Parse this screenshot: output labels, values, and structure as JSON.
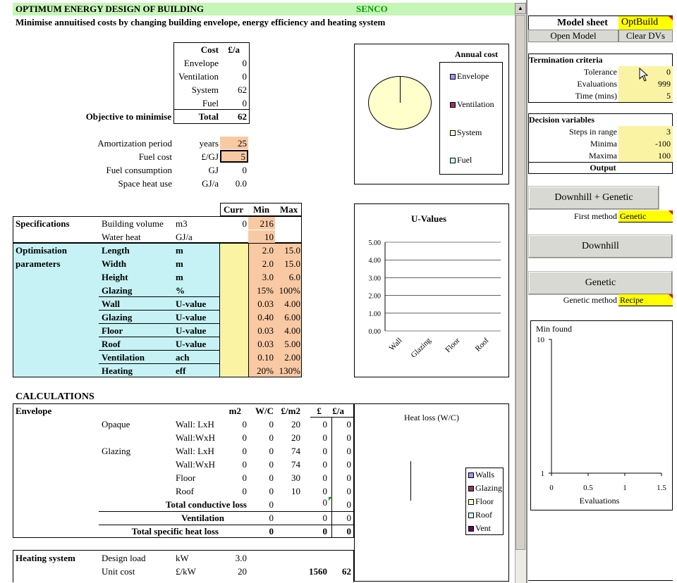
{
  "header": {
    "title": "OPTIMUM ENERGY DESIGN OF BUILDING",
    "brand": "SENCO",
    "subtitle": "Minimise annuitised costs by changing building envelope, energy efficiency and heating system"
  },
  "cost_table": {
    "col1": "Cost",
    "col2": "£/a",
    "rows": [
      {
        "label": "Envelope",
        "value": "0"
      },
      {
        "label": "Ventilation",
        "value": "0"
      },
      {
        "label": "System",
        "value": "62"
      },
      {
        "label": "Fuel",
        "value": "0"
      }
    ],
    "objective_label": "Objective to minimise",
    "total_label": "Total",
    "total_value": "62"
  },
  "params": [
    {
      "label": "Amortization period",
      "unit": "years",
      "value": "25"
    },
    {
      "label": "Fuel cost",
      "unit": "£/GJ",
      "value": "5"
    },
    {
      "label": "Fuel consumption",
      "unit": "GJ",
      "value": "0"
    },
    {
      "label": "Space heat use",
      "unit": "GJ/a",
      "value": "0.0"
    }
  ],
  "annual_chart": {
    "title": "Annual cost",
    "legend": [
      "Envelope",
      "Ventilation",
      "System",
      "Fuel"
    ],
    "colors": [
      "#9999ff",
      "#993366",
      "#ffffcc",
      "#ccffff"
    ]
  },
  "spec": {
    "h_curr": "Curr",
    "h_min": "Min",
    "h_max": "Max",
    "specifications": "Specifications",
    "building_volume": "Building volume",
    "bv_unit": "m3",
    "bv_curr": "0",
    "bv_min": "216",
    "water_heat": "Water heat",
    "wh_unit": "GJ/a",
    "wh_min": "10",
    "opt_label1": "Optimisation",
    "opt_label2": "parameters",
    "rows": [
      {
        "name": "Length",
        "unit": "m",
        "min": "2.0",
        "max": "15.0"
      },
      {
        "name": "Width",
        "unit": "m",
        "min": "2.0",
        "max": "15.0"
      },
      {
        "name": "Height",
        "unit": "m",
        "min": "3.0",
        "max": "6.0"
      },
      {
        "name": "Glazing",
        "unit": "%",
        "min": "15%",
        "max": "100%"
      },
      {
        "name": "Wall",
        "unit": "U-value",
        "min": "0.03",
        "max": "4.00"
      },
      {
        "name": "Glazing",
        "unit": "U-value",
        "min": "0.40",
        "max": "6.00"
      },
      {
        "name": "Floor",
        "unit": "U-value",
        "min": "0.03",
        "max": "4.00"
      },
      {
        "name": "Roof",
        "unit": "U-value",
        "min": "0.03",
        "max": "5.00"
      },
      {
        "name": "Ventilation",
        "unit": "ach",
        "min": "0.10",
        "max": "2.00"
      },
      {
        "name": "Heating",
        "unit": "eff",
        "min": "20%",
        "max": "130%"
      }
    ]
  },
  "chart_data": [
    {
      "type": "pie",
      "title": "Annual cost",
      "categories": [
        "Envelope",
        "Ventilation",
        "System",
        "Fuel"
      ],
      "values": [
        0,
        0,
        62,
        0
      ]
    },
    {
      "type": "bar",
      "title": "U-Values",
      "categories": [
        "Wall",
        "Glazing",
        "Floor",
        "Roof"
      ],
      "values": [
        0,
        0,
        0,
        0
      ],
      "ylim": [
        0,
        5
      ],
      "yticks": [
        "5.00",
        "4.00",
        "3.00",
        "2.00",
        "1.00",
        "0.00"
      ]
    },
    {
      "type": "scatter",
      "title": "Min found",
      "xlabel": "Evaluations",
      "xlim": [
        0,
        1.5
      ],
      "ylim": [
        1,
        10
      ],
      "xticks": [
        "0",
        "0.5",
        "1",
        "1.5"
      ],
      "yticks": [
        "10",
        "1"
      ]
    },
    {
      "type": "bar",
      "title": "Heat loss (W/C)",
      "categories": [
        "Walls",
        "Glazing",
        "Floor",
        "Roof",
        "Vent"
      ],
      "values": [
        0,
        0,
        0,
        0,
        0
      ]
    }
  ],
  "calc": {
    "title": "CALCULATIONS",
    "envelope": "Envelope",
    "headers": [
      "m2",
      "W/C",
      "£/m2",
      "£",
      "£/a"
    ],
    "rows": [
      {
        "group": "Opaque",
        "item": "Wall: LxH",
        "m2": "0",
        "wc": "0",
        "pm2": "20",
        "p": "0",
        "pa": "0"
      },
      {
        "group": "",
        "item": "Wall:WxH",
        "m2": "0",
        "wc": "0",
        "pm2": "20",
        "p": "0",
        "pa": "0"
      },
      {
        "group": "Glazing",
        "item": "Wall: LxH",
        "m2": "0",
        "wc": "0",
        "pm2": "74",
        "p": "0",
        "pa": "0"
      },
      {
        "group": "",
        "item": "Wall:WxH",
        "m2": "0",
        "wc": "0",
        "pm2": "74",
        "p": "0",
        "pa": "0"
      },
      {
        "group": "",
        "item": "Floor",
        "m2": "0",
        "wc": "0",
        "pm2": "30",
        "p": "0",
        "pa": "0"
      },
      {
        "group": "",
        "item": "Roof",
        "m2": "0",
        "wc": "0",
        "pm2": "10",
        "p": "0",
        "pa": "0"
      }
    ],
    "tcl_label": "Total conductive loss",
    "tcl_m2": "0",
    "tcl_p": "0",
    "tcl_pa": "0",
    "vent_label": "Ventilation",
    "vent_m2": "0",
    "vent_p": "0",
    "vent_pa": "0",
    "tshl_label": "Total specific heat loss",
    "tshl_m2": "0",
    "tshl_p": "0",
    "tshl_pa": "0",
    "heatloss_title": "Heat loss (W/C)",
    "heatloss_legend": [
      "Walls",
      "Glazing",
      "Floor",
      "Roof",
      "Vent"
    ],
    "heatloss_colors": [
      "#9999ff",
      "#993366",
      "#ffffcc",
      "#ccffff",
      "#660066"
    ]
  },
  "heating": {
    "label": "Heating system",
    "design_load": "Design load",
    "dl_unit": "kW",
    "dl_value": "3.0",
    "unit_cost": "Unit cost",
    "uc_unit": "£/kW",
    "uc_value": "20",
    "uc_total": "1560",
    "uc_pa": "62"
  },
  "panel": {
    "model_sheet_label": "Model sheet",
    "model_sheet_value": "OptBuild",
    "open_model": "Open Model",
    "clear_dvs": "Clear DVs",
    "term_title": "Termination criteria",
    "term": [
      {
        "label": "Tolerance",
        "value": "0"
      },
      {
        "label": "Evaluations",
        "value": "999"
      },
      {
        "label": "Time (mins)",
        "value": "5"
      }
    ],
    "dv_title": "Decision variables",
    "dv": [
      {
        "label": "Steps in range",
        "value": "3"
      },
      {
        "label": "Minima",
        "value": "-100"
      },
      {
        "label": "Maxima",
        "value": "100"
      }
    ],
    "output": "Output",
    "btn_downhill_genetic": "Downhill + Genetic",
    "first_method_label": "First method",
    "first_method_value": "Genetic",
    "btn_downhill": "Downhill",
    "btn_genetic": "Genetic",
    "genetic_method_label": "Genetic method",
    "genetic_method_value": "Recipe",
    "min_found": "Min found",
    "evaluations": "Evaluations"
  }
}
